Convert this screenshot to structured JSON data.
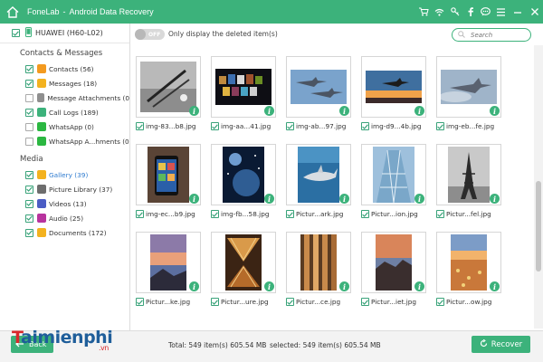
{
  "window": {
    "app_name": "FoneLab",
    "separator": "-",
    "module_name": "Android Data Recovery",
    "toolbar_icons": [
      "cart-icon",
      "wifi-icon",
      "key-icon",
      "facebook-icon",
      "chat-icon",
      "menu-icon"
    ],
    "window_controls": [
      "minimize-icon",
      "close-icon"
    ]
  },
  "sidebar": {
    "device_name": "HUAWEI (H60-L02)",
    "device_checked": true,
    "sections": [
      {
        "title": "Contacts & Messages",
        "items": [
          {
            "label": "Contacts (56)",
            "checked": true,
            "icon": "contacts-icon",
            "color": "#f39a1f"
          },
          {
            "label": "Messages (18)",
            "checked": true,
            "icon": "messages-icon",
            "color": "#f3b21f"
          },
          {
            "label": "Message Attachments (0",
            "checked": false,
            "icon": "attachment-icon",
            "color": "#8f8f8f"
          },
          {
            "label": "Call Logs (189)",
            "checked": true,
            "icon": "call-logs-icon",
            "color": "#3cb27b"
          },
          {
            "label": "WhatsApp (0)",
            "checked": false,
            "icon": "whatsapp-icon",
            "color": "#2bb741"
          },
          {
            "label": "WhatsApp A...hments (0",
            "checked": false,
            "icon": "whatsapp-attachment-icon",
            "color": "#2bb741"
          }
        ]
      },
      {
        "title": "Media",
        "items": [
          {
            "label": "Gallery (39)",
            "checked": true,
            "icon": "gallery-icon",
            "color": "#f3b21f",
            "selected": true
          },
          {
            "label": "Picture Library (37)",
            "checked": true,
            "icon": "picture-library-icon",
            "color": "#6d6d6d"
          },
          {
            "label": "Videos (13)",
            "checked": true,
            "icon": "videos-icon",
            "color": "#4b5cc4"
          },
          {
            "label": "Audio (25)",
            "checked": true,
            "icon": "audio-icon",
            "color": "#b8339e"
          },
          {
            "label": "Documents (172)",
            "checked": true,
            "icon": "documents-icon",
            "color": "#f3b21f"
          }
        ]
      }
    ]
  },
  "filter": {
    "toggle_state": "OFF",
    "toggle_label": "Only display the deleted item(s)",
    "search_placeholder": "Search"
  },
  "grid": {
    "items": [
      {
        "name": "img-83...b8.jpg",
        "checked": true,
        "thumb": "pens-photo"
      },
      {
        "name": "img-aa...41.jpg",
        "checked": true,
        "thumb": "screens-wall-photo"
      },
      {
        "name": "img-ab...97.jpg",
        "checked": true,
        "thumb": "jets-sky-photo"
      },
      {
        "name": "img-d9...4b.jpg",
        "checked": true,
        "thumb": "jet-sunset-photo"
      },
      {
        "name": "img-eb...fe.jpg",
        "checked": true,
        "thumb": "jet-cloudy-photo"
      },
      {
        "name": "img-ec...b9.jpg",
        "checked": true,
        "thumb": "phone-in-hand-photo"
      },
      {
        "name": "img-fb...58.jpg",
        "checked": true,
        "thumb": "planet-space-photo"
      },
      {
        "name": "Pictur...ark.jpg",
        "checked": true,
        "thumb": "shark-photo"
      },
      {
        "name": "Pictur...ion.jpg",
        "checked": true,
        "thumb": "glass-building-photo"
      },
      {
        "name": "Pictur...fel.jpg",
        "checked": true,
        "thumb": "eiffel-tower-photo"
      },
      {
        "name": "Pictur...ke.jpg",
        "checked": true,
        "thumb": "lake-sunset-photo"
      },
      {
        "name": "Pictur...ure.jpg",
        "checked": true,
        "thumb": "tunnel-perspective-photo"
      },
      {
        "name": "Pictur...ce.jpg",
        "checked": true,
        "thumb": "pillars-photo"
      },
      {
        "name": "Pictur...iet.jpg",
        "checked": true,
        "thumb": "rocky-coast-photo"
      },
      {
        "name": "Pictur...ow.jpg",
        "checked": true,
        "thumb": "flower-field-photo"
      }
    ]
  },
  "footer": {
    "back_label": "Back",
    "total_text": "Total: 549 item(s) 605.54 MB",
    "selected_text": "selected: 549 item(s) 605.54 MB",
    "recover_label": "Recover"
  },
  "watermark": {
    "text_main": "aimienphi",
    "text_t": "T",
    "text_suffix": ".vn"
  },
  "colors": {
    "accent": "#3cb27b",
    "selected_text": "#2e7bcf"
  }
}
